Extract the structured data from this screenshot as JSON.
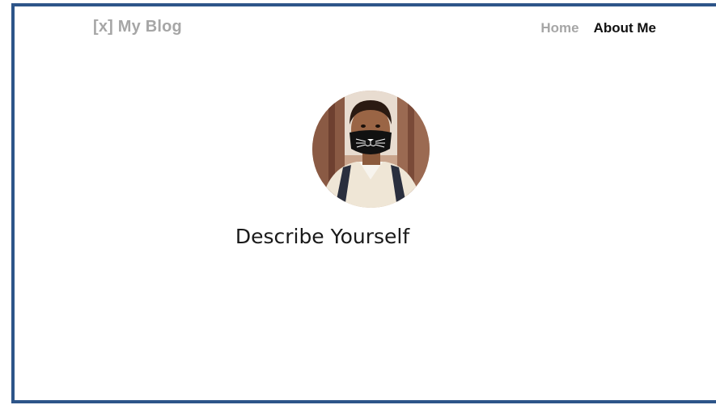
{
  "header": {
    "logo_text": "[x] My Blog",
    "nav": {
      "home_label": "Home",
      "about_label": "About Me"
    }
  },
  "main": {
    "avatar_alt": "profile-photo",
    "tagline": "Describe Yourself"
  },
  "colors": {
    "frame_border": "#2d5589",
    "muted_text": "#a6a6a6",
    "active_nav": "#111111"
  }
}
